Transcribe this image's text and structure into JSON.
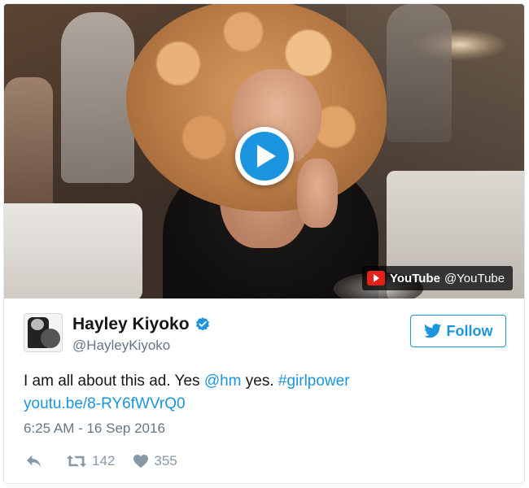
{
  "colors": {
    "accent": "#1b95e0",
    "text_primary": "#14171a",
    "text_secondary": "#657786",
    "icon_gray": "#8899a6",
    "youtube_red": "#e62117"
  },
  "media": {
    "badge_brand": "YouTube",
    "badge_handle": "@YouTube",
    "play_icon": "play-icon"
  },
  "user": {
    "display_name": "Hayley Kiyoko",
    "handle": "@HayleyKiyoko",
    "verified": true
  },
  "follow_button": {
    "label": "Follow",
    "icon": "twitter-bird-icon"
  },
  "tweet": {
    "text_prefix": "I am all about this ad. Yes ",
    "mention": "@hm",
    "text_middle": " yes. ",
    "hashtag": "#girlpower",
    "url": "youtu.be/8-RY6fWVrQ0",
    "timestamp": "6:25 AM - 16 Sep 2016"
  },
  "actions": {
    "reply_icon": "reply-icon",
    "retweet_icon": "retweet-icon",
    "retweet_count": "142",
    "like_icon": "heart-icon",
    "like_count": "355"
  }
}
